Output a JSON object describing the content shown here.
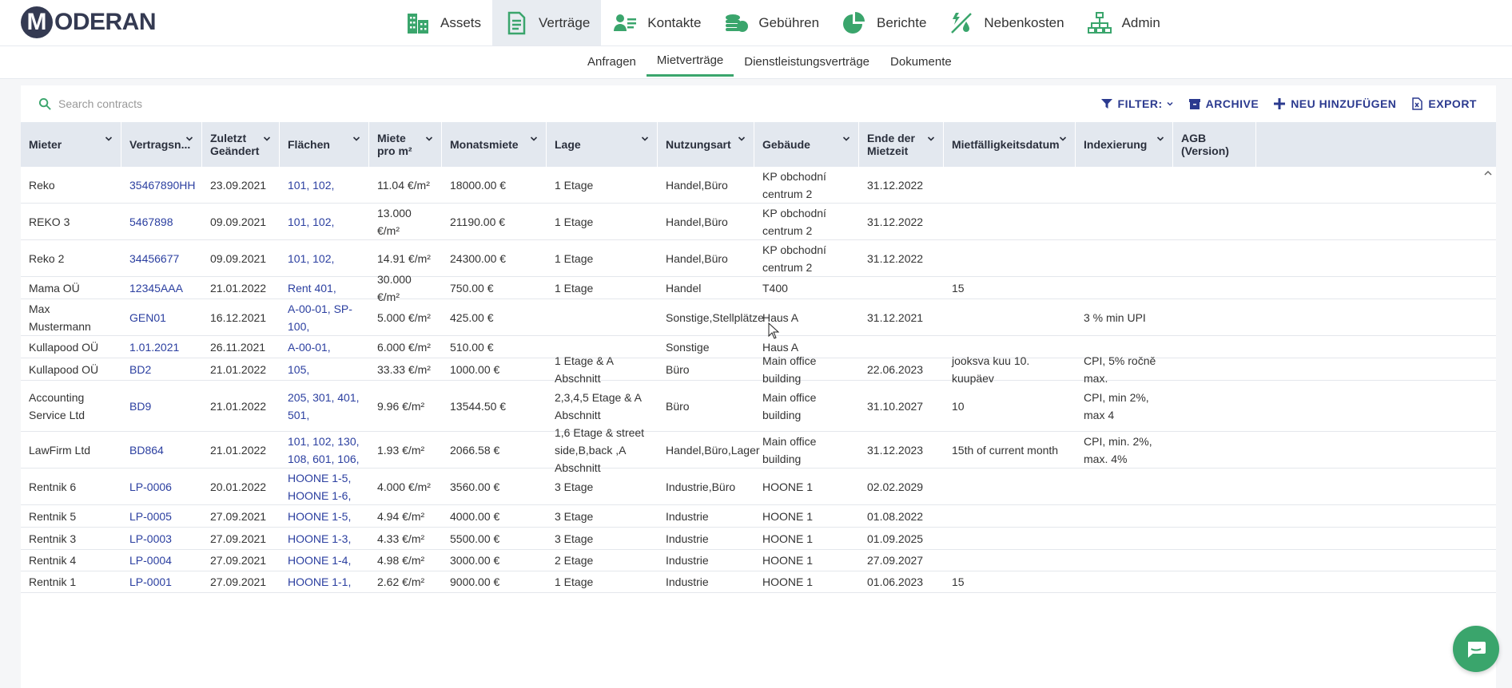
{
  "brand": {
    "logo_letter": "M",
    "logo_text": "ODERAN"
  },
  "main_nav": [
    {
      "label": "Assets",
      "icon": "building-icon"
    },
    {
      "label": "Verträge",
      "icon": "document-icon",
      "active": true
    },
    {
      "label": "Kontakte",
      "icon": "contacts-icon"
    },
    {
      "label": "Gebühren",
      "icon": "coins-icon"
    },
    {
      "label": "Berichte",
      "icon": "pie-chart-icon"
    },
    {
      "label": "Nebenkosten",
      "icon": "utilities-icon"
    },
    {
      "label": "Admin",
      "icon": "org-chart-icon"
    }
  ],
  "sub_nav": [
    {
      "label": "Anfragen"
    },
    {
      "label": "Mietverträge",
      "active": true
    },
    {
      "label": "Dienstleistungsverträge"
    },
    {
      "label": "Dokumente"
    }
  ],
  "toolbar": {
    "search_placeholder": "Search contracts",
    "filter_label": "FILTER:",
    "archive_label": "ARCHIVE",
    "add_label": "NEU HINZUFÜGEN",
    "export_label": "EXPORT"
  },
  "colors": {
    "accent_green": "#3aa56c",
    "link_blue": "#2b3fa0",
    "header_bg": "#e3e8ef",
    "brand_dark": "#343a52"
  },
  "table": {
    "columns": [
      {
        "label": "Mieter"
      },
      {
        "label": "Vertragsn..."
      },
      {
        "label": "Zuletzt Geändert"
      },
      {
        "label": "Flächen"
      },
      {
        "label": "Miete pro m²"
      },
      {
        "label": "Monatsmiete"
      },
      {
        "label": "Lage"
      },
      {
        "label": "Nutzungsart"
      },
      {
        "label": "Gebäude"
      },
      {
        "label": "Ende der Mietzeit"
      },
      {
        "label": "Mietfälligkeitsdatum"
      },
      {
        "label": "Indexierung"
      },
      {
        "label": "AGB (Version)"
      }
    ],
    "rows": [
      [
        "Reko",
        "35467890HH",
        "23.09.2021",
        "101, 102,",
        "11.04 €/m²",
        "18000.00 €",
        "1 Etage",
        "Handel,Büro",
        "KP obchodní centrum 2",
        "31.12.2022",
        "",
        "",
        ""
      ],
      [
        "REKO 3",
        "5467898",
        "09.09.2021",
        "101, 102,",
        "13.000 €/m²",
        "21190.00 €",
        "1 Etage",
        "Handel,Büro",
        "KP obchodní centrum 2",
        "31.12.2022",
        "",
        "",
        ""
      ],
      [
        "Reko 2",
        "34456677",
        "09.09.2021",
        "101, 102,",
        "14.91 €/m²",
        "24300.00 €",
        "1 Etage",
        "Handel,Büro",
        "KP obchodní centrum 2",
        "31.12.2022",
        "",
        "",
        ""
      ],
      [
        "Mama OÜ",
        "12345AAA",
        "21.01.2022",
        "Rent 401,",
        "30.000 €/m²",
        "750.00 €",
        "1 Etage",
        "Handel",
        "T400",
        "",
        "15",
        "",
        ""
      ],
      [
        "Max Mustermann",
        "GEN01",
        "16.12.2021",
        "A-00-01, SP-100,",
        "5.000 €/m²",
        "425.00 €",
        "",
        "Sonstige,Stellplätze",
        "Haus A",
        "31.12.2021",
        "",
        "3 % min UPI",
        ""
      ],
      [
        "Kullapood OÜ",
        "1.01.2021",
        "26.11.2021",
        "A-00-01,",
        "6.000 €/m²",
        "510.00 €",
        "",
        "Sonstige",
        "Haus A",
        "",
        "",
        "",
        ""
      ],
      [
        "Kullapood OÜ",
        "BD2",
        "21.01.2022",
        "105,",
        "33.33 €/m²",
        "1000.00 €",
        "1 Etage & A Abschnitt",
        "Büro",
        "Main office building",
        "22.06.2023",
        "jooksva kuu 10. kuupäev",
        "CPI, 5% ročně max.",
        ""
      ],
      [
        "Accounting Service Ltd",
        "BD9",
        "21.01.2022",
        "205, 301, 401, 501,",
        "9.96 €/m²",
        "13544.50 €",
        "2,3,4,5 Etage & A Abschnitt",
        "Büro",
        "Main office building",
        "31.10.2027",
        "10",
        "CPI, min 2%, max 4",
        ""
      ],
      [
        "LawFirm Ltd",
        "BD864",
        "21.01.2022",
        "101, 102, 130, 108, 601, 106,",
        "1.93 €/m²",
        "2066.58 €",
        "1,6 Etage & street side,B,back ,A Abschnitt",
        "Handel,Büro,Lager",
        "Main office building",
        "31.12.2023",
        "15th of current month",
        "CPI, min. 2%, max. 4%",
        ""
      ],
      [
        "Rentnik 6",
        "LP-0006",
        "20.01.2022",
        "HOONE 1-5, HOONE 1-6,",
        "4.000 €/m²",
        "3560.00 €",
        "3 Etage",
        "Industrie,Büro",
        "HOONE 1",
        "02.02.2029",
        "",
        "",
        ""
      ],
      [
        "Rentnik 5",
        "LP-0005",
        "27.09.2021",
        "HOONE 1-5,",
        "4.94 €/m²",
        "4000.00 €",
        "3 Etage",
        "Industrie",
        "HOONE 1",
        "01.08.2022",
        "",
        "",
        ""
      ],
      [
        "Rentnik 3",
        "LP-0003",
        "27.09.2021",
        "HOONE 1-3,",
        "4.33 €/m²",
        "5500.00 €",
        "3 Etage",
        "Industrie",
        "HOONE 1",
        "01.09.2025",
        "",
        "",
        ""
      ],
      [
        "Rentnik 4",
        "LP-0004",
        "27.09.2021",
        "HOONE 1-4,",
        "4.98 €/m²",
        "3000.00 €",
        "2 Etage",
        "Industrie",
        "HOONE 1",
        "27.09.2027",
        "",
        "",
        ""
      ],
      [
        "Rentnik 1",
        "LP-0001",
        "27.09.2021",
        "HOONE 1-1,",
        "2.62 €/m²",
        "9000.00 €",
        "1 Etage",
        "Industrie",
        "HOONE 1",
        "01.06.2023",
        "15",
        "",
        ""
      ]
    ]
  }
}
